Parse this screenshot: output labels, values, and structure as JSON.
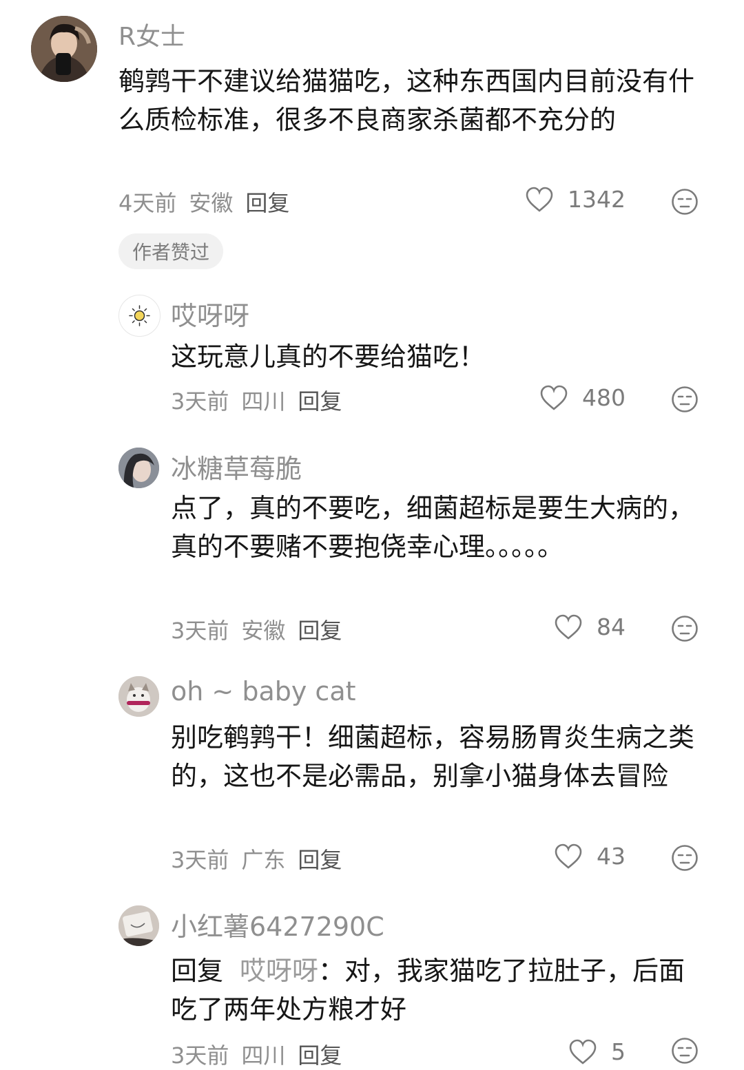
{
  "comments": [
    {
      "username": "R女士",
      "text": "鹌鹑干不建议给猫猫吃，这种东西国内目前没有什么质检标准，很多不良商家杀菌都不充分的",
      "time": "4天前",
      "location": "安徽",
      "reply_label": "回复",
      "likes": "1342",
      "badge": "作者赞过"
    },
    {
      "username": "哎呀呀",
      "text": "这玩意儿真的不要给猫吃！",
      "time": "3天前",
      "location": "四川",
      "reply_label": "回复",
      "likes": "480"
    },
    {
      "username": "冰糖草莓脆",
      "text": "点了，真的不要吃，细菌超标是要生大病的，真的不要赌不要抱侥幸心理。。。。。",
      "time": "3天前",
      "location": "安徽",
      "reply_label": "回复",
      "likes": "84"
    },
    {
      "username": "oh ~ baby cat",
      "text": "别吃鹌鹑干！细菌超标，容易肠胃炎生病之类的，这也不是必需品，别拿小猫身体去冒险",
      "time": "3天前",
      "location": "广东",
      "reply_label": "回复",
      "likes": "43"
    },
    {
      "username": "小红薯6427290C",
      "reply_prefix": "回复",
      "reply_target": "哎呀呀",
      "text": "：对，我家猫吃了拉肚子，后面吃了两年处方粮才好",
      "time": "3天前",
      "location": "四川",
      "reply_label": "回复",
      "likes": "5"
    }
  ]
}
